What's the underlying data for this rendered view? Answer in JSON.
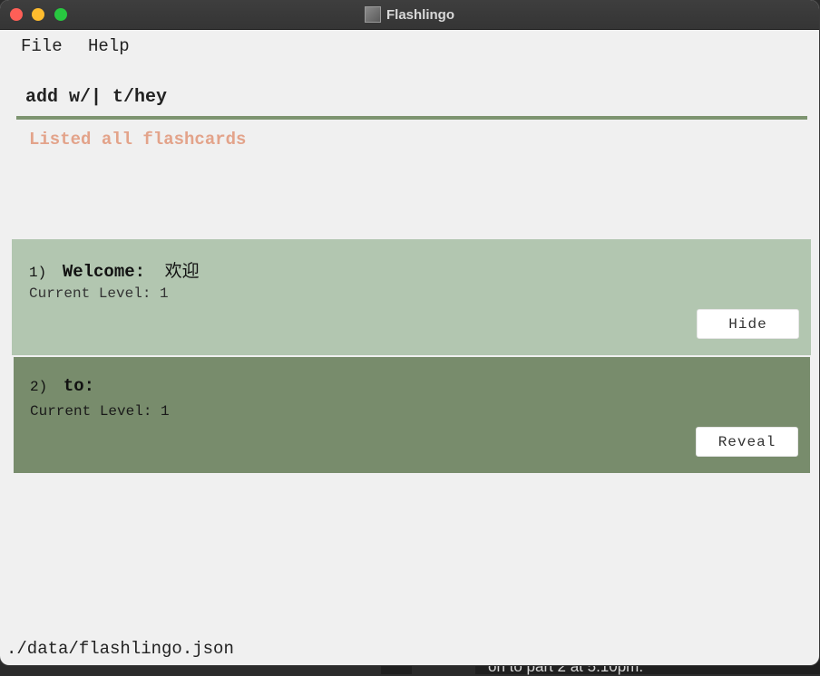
{
  "background": {
    "partial_text": "on to part 2 at 5.10pm."
  },
  "window": {
    "title": "Flashlingo",
    "icon": "app-icon"
  },
  "menu": {
    "items": [
      "File",
      "Help"
    ]
  },
  "command": {
    "value": "add w/| t/hey"
  },
  "result": {
    "message": "Listed all flashcards",
    "color": "#e3a38a"
  },
  "flashcards": [
    {
      "index": "1)",
      "word": "Welcome:",
      "translation": "欢迎",
      "level_text": "Current Level: 1",
      "button_label": "Hide",
      "color": "#b2c6b0"
    },
    {
      "index": "2)",
      "word": "to:",
      "translation": "",
      "level_text": "Current Level: 1",
      "button_label": "Reveal",
      "color": "#788c6c"
    }
  ],
  "status": {
    "file_path": "./data/flashlingo.json"
  },
  "colors": {
    "accent": "#7d9470"
  }
}
